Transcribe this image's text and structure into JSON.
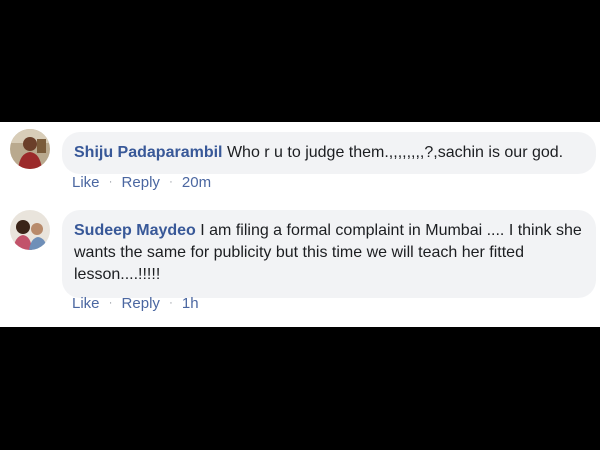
{
  "comments": [
    {
      "author": "Shiju Padaparambil",
      "text": "Who r u to judge them.,,,,,,,,?,sachin is our god.",
      "like_label": "Like",
      "reply_label": "Reply",
      "time": "20m",
      "avatar_icon": "profile-photo"
    },
    {
      "author": "Sudeep Maydeo",
      "text": "I am filing a formal complaint in Mumbai .... I think she wants the same for publicity but this time we will teach her fitted lesson....!!!!!",
      "like_label": "Like",
      "reply_label": "Reply",
      "time": "1h",
      "avatar_icon": "profile-photo"
    }
  ],
  "separator": "·",
  "colors": {
    "author": "#385898",
    "bubble": "#f2f3f5",
    "link": "#4b67a1",
    "meta": "#90949c",
    "background": "#000000"
  }
}
